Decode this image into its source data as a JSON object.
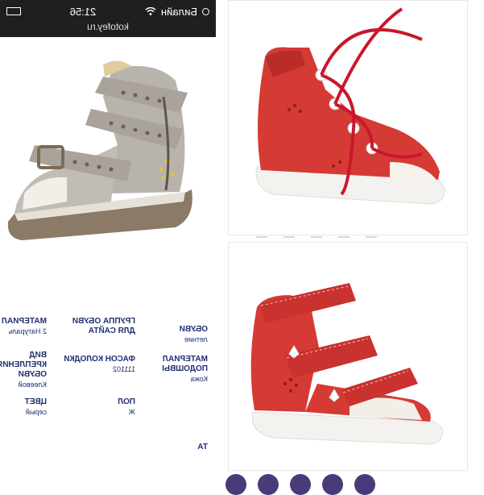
{
  "status_bar": {
    "carrier": "Билайн",
    "time": "21:56",
    "url": "kotofey.ru"
  },
  "specs": [
    {
      "label": "ОБУВИ",
      "value": "летние"
    },
    {
      "label": "ГРУППА ОБУВИ ДЛЯ САЙТА",
      "value": ""
    },
    {
      "label": "МАТЕРИАЛ",
      "value": "2 Натураль"
    },
    {
      "label": "МАТЕРИАЛ ПОДОШВЫ",
      "value": "Кожа"
    },
    {
      "label": "ФАСОН КОЛОДКИ",
      "value": "111102"
    },
    {
      "label": "ВИД КРЕПЛЕНИЯ ОБУВИ",
      "value": "Клеевой"
    },
    {
      "label": "ПОЛ",
      "value": "Ж"
    },
    {
      "label": "ЦВЕТ",
      "value": "серый"
    },
    {
      "label": "ТА",
      "value": ""
    }
  ],
  "icons": {
    "wifi": "wifi-icon",
    "status_dot": "status-dot-icon"
  },
  "colors": {
    "status_bar_bg": "#1f1f1f",
    "spec_text": "#1e2f72",
    "red_shoe": "#d63a35",
    "gray_shoe": "#b8b3ad"
  }
}
